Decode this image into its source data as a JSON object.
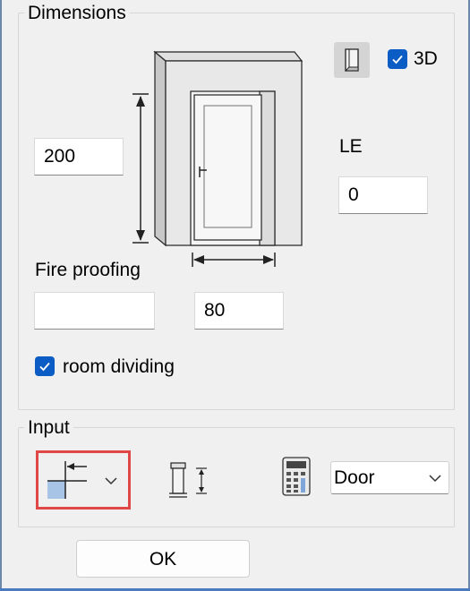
{
  "dimensions": {
    "group_label": "Dimensions",
    "height_value": "200",
    "width_value": "80",
    "le_label": "LE",
    "le_value": "0",
    "fire_proofing_label": "Fire proofing",
    "fire_proofing_value": "",
    "three_d_label": "3D",
    "three_d_checked": true,
    "room_dividing_label": "room dividing",
    "room_dividing_checked": true
  },
  "input": {
    "group_label": "Input",
    "type_select_value": "Door",
    "type_options": [
      "Door"
    ]
  },
  "ok_label": "OK",
  "colors": {
    "checkbox_accent": "#0b5cc4",
    "highlight_border": "#e04848"
  },
  "icons": {
    "view_toggle": "door-view-icon",
    "placement": "placement-mode-icon",
    "frame_height": "frame-height-icon",
    "calculator": "calculator-icon"
  }
}
